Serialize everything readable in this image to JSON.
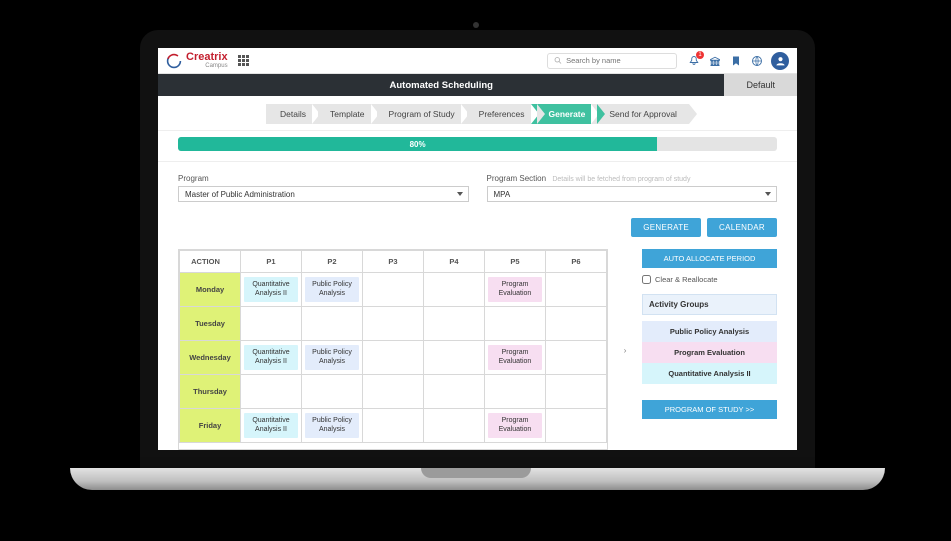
{
  "brand": {
    "name": "Creatrix",
    "sub": "Campus"
  },
  "search": {
    "placeholder": "Search by name"
  },
  "notif_badge": "1",
  "darkbar": {
    "title": "Automated Scheduling",
    "default_label": "Default"
  },
  "wizard": {
    "steps": [
      "Details",
      "Template",
      "Program of Study",
      "Preferences",
      "Generate",
      "Send for Approval"
    ],
    "active_index": 4
  },
  "progress": {
    "percent": 80,
    "label": "80%"
  },
  "program": {
    "label": "Program",
    "value": "Master of Public Administration",
    "section_label": "Program Section",
    "section_hint": "Details will be fetched from program of study",
    "section_value": "MPA"
  },
  "action_buttons": {
    "generate": "GENERATE",
    "calendar": "CALENDAR"
  },
  "schedule": {
    "action_label": "ACTION",
    "periods": [
      "P1",
      "P2",
      "P3",
      "P4",
      "P5",
      "P6"
    ],
    "days": [
      "Monday",
      "Tuesday",
      "Wednesday",
      "Thursday",
      "Friday"
    ],
    "cells": {
      "Monday": [
        "Quantitative Analysis II",
        "Public Policy Analysis",
        "",
        "",
        "Program Evaluation",
        ""
      ],
      "Tuesday": [
        "",
        "",
        "",
        "",
        "",
        ""
      ],
      "Wednesday": [
        "Quantitative Analysis II",
        "Public Policy Analysis",
        "",
        "",
        "Program Evaluation",
        ""
      ],
      "Thursday": [
        "",
        "",
        "",
        "",
        "",
        ""
      ],
      "Friday": [
        "Quantitative Analysis II",
        "Public Policy Analysis",
        "",
        "",
        "Program Evaluation",
        ""
      ]
    },
    "colors": {
      "Quantitative Analysis II": "c-cyan",
      "Public Policy Analysis": "c-blue",
      "Program Evaluation": "c-pink"
    }
  },
  "sidepanel": {
    "auto_allocate": "AUTO ALLOCATE PERIOD",
    "clear_label": "Clear & Reallocate",
    "groups_title": "Activity Groups",
    "groups": [
      {
        "label": "Public Policy Analysis",
        "cls": "ag-blue"
      },
      {
        "label": "Program Evaluation",
        "cls": "ag-pink"
      },
      {
        "label": "Quantitative Analysis II",
        "cls": "ag-cyan"
      }
    ],
    "program_link": "PROGRAM OF STUDY >>"
  }
}
